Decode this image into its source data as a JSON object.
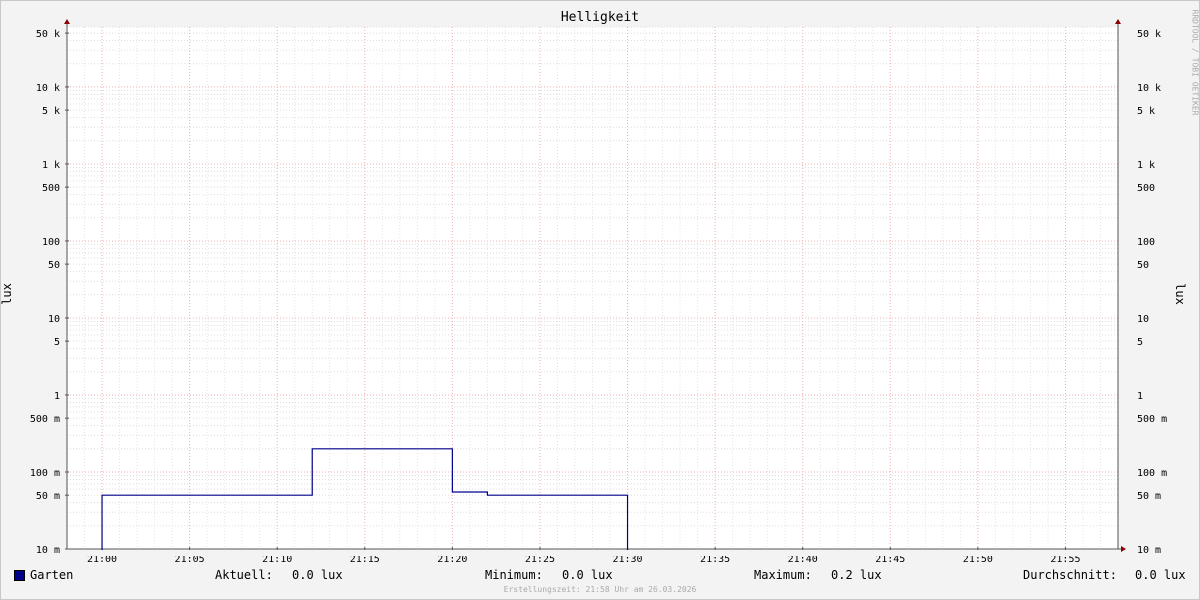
{
  "chart_data": {
    "type": "line",
    "title": "Helligkeit",
    "ylabel": "lux",
    "yscale": "log",
    "ylim": [
      0.01,
      60000
    ],
    "xlim": [
      "20:58",
      "21:58"
    ],
    "y_ticks_labeled": [
      {
        "value": 50000,
        "label": "50 k"
      },
      {
        "value": 10000,
        "label": "10 k"
      },
      {
        "value": 5000,
        "label": "5 k"
      },
      {
        "value": 1000,
        "label": "1 k"
      },
      {
        "value": 500,
        "label": "500"
      },
      {
        "value": 100,
        "label": "100"
      },
      {
        "value": 50,
        "label": "50"
      },
      {
        "value": 10,
        "label": "10"
      },
      {
        "value": 5,
        "label": "5"
      },
      {
        "value": 1,
        "label": "1"
      },
      {
        "value": 0.5,
        "label": "500 m"
      },
      {
        "value": 0.1,
        "label": "100 m"
      },
      {
        "value": 0.05,
        "label": "50 m"
      },
      {
        "value": 0.01,
        "label": "10 m"
      }
    ],
    "x_ticks": [
      "21:00",
      "21:05",
      "21:10",
      "21:15",
      "21:20",
      "21:25",
      "21:30",
      "21:35",
      "21:40",
      "21:45",
      "21:50",
      "21:55"
    ],
    "grid": true,
    "series": [
      {
        "name": "Garten",
        "color": "#00008b",
        "step": true,
        "x": [
          "21:00",
          "21:12",
          "21:20",
          "21:22",
          "21:30",
          "21:58"
        ],
        "y": [
          0.05,
          0.2,
          0.055,
          0.05,
          0,
          0
        ]
      }
    ],
    "legend": {
      "series_name": "Garten",
      "stats": [
        {
          "label": "Aktuell:",
          "value": "0.0 lux"
        },
        {
          "label": "Minimum:",
          "value": "0.0 lux"
        },
        {
          "label": "Maximum:",
          "value": "0.2 lux"
        },
        {
          "label": "Durchschnitt:",
          "value": "0.0 lux"
        }
      ]
    },
    "watermark": "RRDTOOL / TOBI OETIKER",
    "footer": "Erstellungszeit: 21:58 Uhr am 26.03.2026"
  }
}
